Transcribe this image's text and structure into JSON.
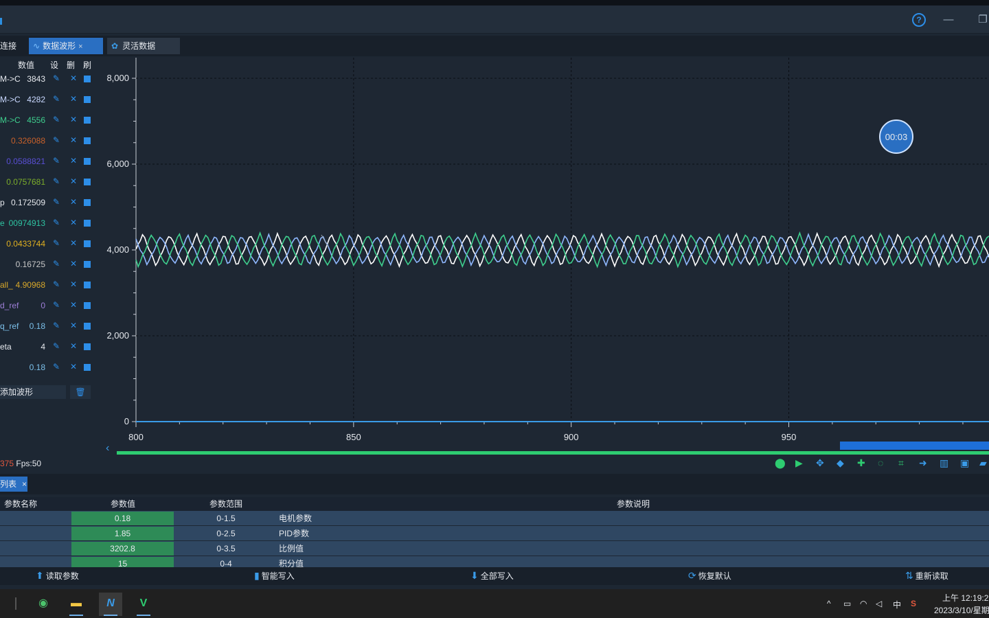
{
  "window": {
    "help_glyph": "?",
    "min_glyph": "—",
    "restore_glyph": "❐"
  },
  "tabs": [
    {
      "label": "连接"
    },
    {
      "label": "数据波形",
      "close": "×"
    },
    {
      "label": "灵活数据"
    }
  ],
  "side_header": {
    "value": "数值",
    "set": "设",
    "del": "删",
    "refresh": "刷"
  },
  "channels": [
    {
      "name": "M->C",
      "value": "3843",
      "color": "#e6e9ee"
    },
    {
      "name": "M->C",
      "value": "4282",
      "color": "#c9d8ff"
    },
    {
      "name": "M->C",
      "value": "4556",
      "color": "#3ecf8e"
    },
    {
      "name": "",
      "value": "0.326088",
      "color": "#c8602a"
    },
    {
      "name": "",
      "value": "0.0588821",
      "color": "#5a4fd6"
    },
    {
      "name": "",
      "value": "0.0757681",
      "color": "#7cae2a"
    },
    {
      "name": "p",
      "value": "0.172509",
      "color": "#e6e9ee"
    },
    {
      "name": "e",
      "value": "00974913",
      "color": "#2ec4a2"
    },
    {
      "name": "",
      "value": "0.0433744",
      "color": "#e0b020"
    },
    {
      "name": "",
      "value": "0.16725",
      "color": "#c8c8c8"
    },
    {
      "name": "all_",
      "value": "4.90968",
      "color": "#d9a82a"
    },
    {
      "name": "d_ref",
      "value": "0",
      "color": "#9e7fd8"
    },
    {
      "name": "q_ref",
      "value": "0.18",
      "color": "#7cc0ea"
    },
    {
      "name": "eta",
      "value": "4",
      "color": "#e6e9ee"
    },
    {
      "name": "",
      "value": "0.18",
      "color": "#7cc0ea"
    }
  ],
  "add_wave_label": "添加波形",
  "icons": {
    "write": "wrench-icon",
    "delete": "close-icon",
    "visible": "checkbox-icon",
    "trash": "trash-icon"
  },
  "chart_data": {
    "type": "line",
    "x_ticks": [
      "800",
      "850",
      "900",
      "950"
    ],
    "y_ticks": [
      "0",
      "2,000",
      "4,000",
      "6,000",
      "8,000"
    ],
    "xlim": [
      800,
      996
    ],
    "ylim": [
      0,
      8000
    ],
    "grid": true,
    "series": [
      {
        "color": "#ffffff",
        "center": 4000,
        "amplitude": 370,
        "period": 6.2,
        "phase": 0
      },
      {
        "color": "#8fb8ff",
        "center": 4000,
        "amplitude": 340,
        "period": 6.2,
        "phase": 2.07
      },
      {
        "color": "#3ecf8e",
        "center": 4000,
        "amplitude": 380,
        "period": 6.2,
        "phase": 4.14
      },
      {
        "color": "#3a9be8",
        "constant": 0
      }
    ],
    "timer_badge": "00:03"
  },
  "status": {
    "count_fragment": "375",
    "fps": "Fps:50"
  },
  "tab2": {
    "label": "列表",
    "close": "×"
  },
  "param_table": {
    "headers": [
      "参数名称",
      "参数值",
      "参数范围",
      "参数说明"
    ],
    "rows": [
      {
        "name": "",
        "value": "0.18",
        "range": "0-1.5",
        "desc": "电机参数"
      },
      {
        "name": "",
        "value": "1.85",
        "range": "0-2.5",
        "desc": "PID参数"
      },
      {
        "name": "",
        "value": "3202.8",
        "range": "0-3.5",
        "desc": "比例值"
      },
      {
        "name": "",
        "value": "15",
        "range": "0-4",
        "desc": "积分值"
      }
    ]
  },
  "bottom_buttons": [
    {
      "label": "读取参数",
      "icon": "upload-icon"
    },
    {
      "label": "智能写入",
      "icon": "bookmark-icon"
    },
    {
      "label": "全部写入",
      "icon": "download-icon"
    },
    {
      "label": "恢复默认",
      "icon": "refresh-icon"
    },
    {
      "label": "重新读取",
      "icon": "reload-icon"
    }
  ],
  "taskbar": {
    "tray_ime": "中",
    "clock_time": "上午 12:19:2",
    "clock_date": "2023/3/10/星期"
  }
}
